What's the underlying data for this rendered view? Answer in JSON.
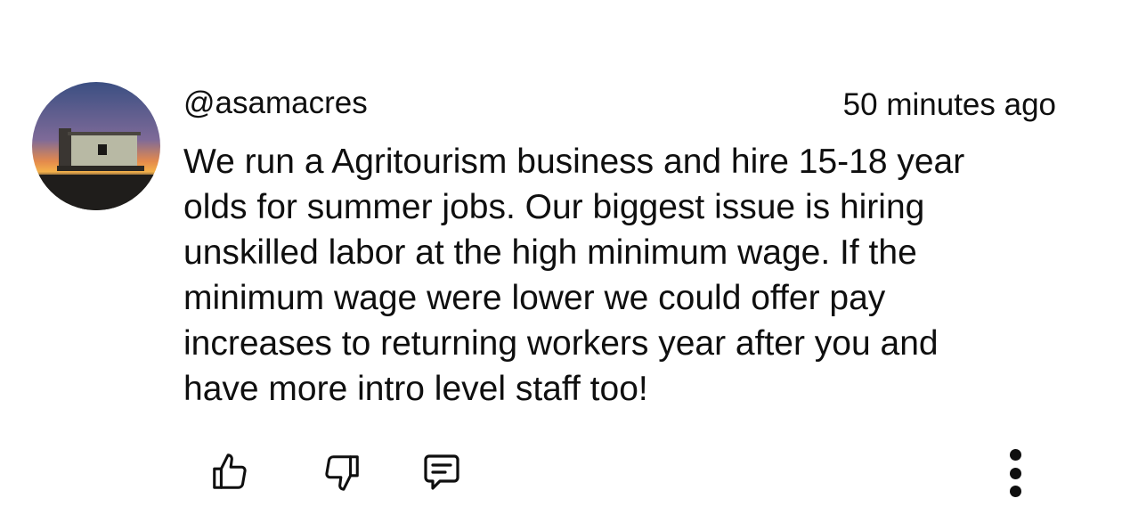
{
  "comment": {
    "avatar_icon": "farmhouse-sunset-avatar",
    "author_handle": "@asamacres",
    "timestamp": "50 minutes ago",
    "body_lines": [
      "We run a Agritourism business and hire 15-18 year",
      "olds for summer jobs. Our biggest issue is hiring",
      "unskilled labor at the high minimum wage. If the",
      "minimum wage were lower we could offer pay",
      "increases to returning workers year after you and",
      "have more intro level staff too!"
    ]
  },
  "actions": {
    "like_icon": "thumbs-up-icon",
    "dislike_icon": "thumbs-down-icon",
    "reply_icon": "comment-reply-icon",
    "more_icon": "more-vertical-icon"
  },
  "colors": {
    "text": "#0f0f0f",
    "background": "#ffffff"
  }
}
